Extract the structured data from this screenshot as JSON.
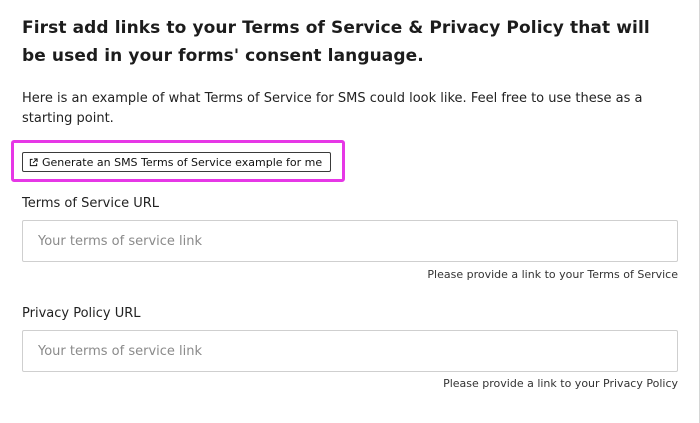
{
  "heading": "First add links to your Terms of Service & Privacy Policy that will be used in your forms' consent language.",
  "intro": "Here is an example of what Terms of Service for SMS could look like. Feel free to use these as a starting point.",
  "generate_button": {
    "label": "Generate an SMS Terms of Service example for me",
    "icon": "external-link-icon"
  },
  "highlight_color": "#e637e6",
  "terms_field": {
    "label": "Terms of Service URL",
    "placeholder": "Your terms of service link",
    "value": "",
    "helper": "Please provide a link to your Terms of Service"
  },
  "privacy_field": {
    "label": "Privacy Policy URL",
    "placeholder": "Your terms of service link",
    "value": "",
    "helper": "Please provide a link to your Privacy Policy"
  }
}
